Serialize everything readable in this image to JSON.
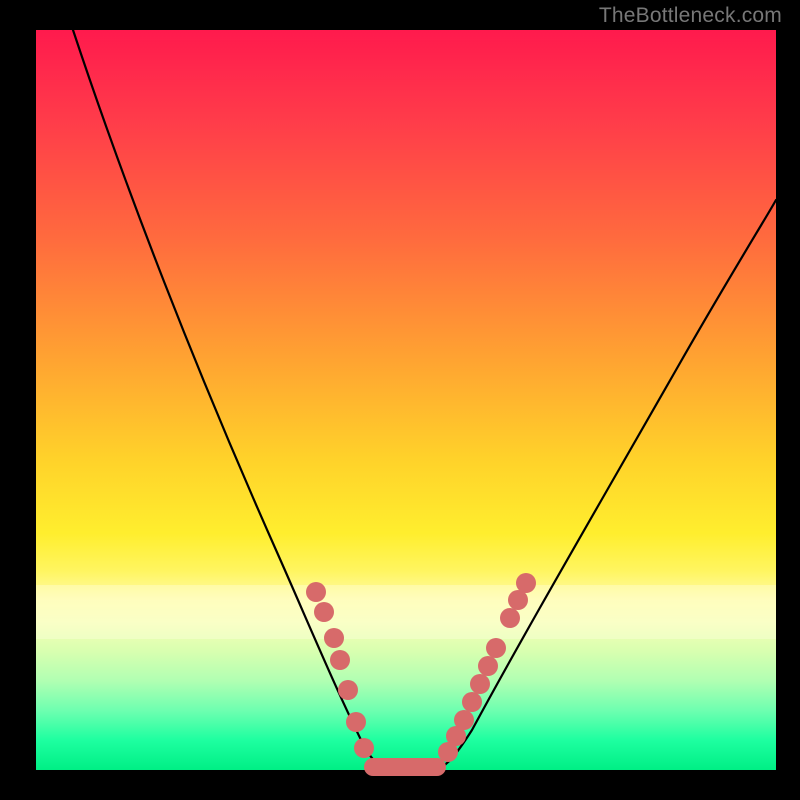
{
  "watermark": "TheBottleneck.com",
  "chart_data": {
    "type": "line",
    "title": "",
    "xlabel": "",
    "ylabel": "",
    "xlim": [
      0,
      100
    ],
    "ylim": [
      0,
      100
    ],
    "grid": false,
    "legend": false,
    "series": [
      {
        "name": "bottleneck-curve",
        "x": [
          5,
          10,
          15,
          20,
          25,
          30,
          35,
          38,
          40,
          42,
          44,
          46,
          48,
          50,
          55,
          60,
          65,
          70,
          75,
          80,
          85,
          90,
          95,
          100
        ],
        "y": [
          100,
          88,
          76,
          64,
          52,
          40,
          28,
          18,
          12,
          7,
          3,
          1,
          0,
          0,
          2,
          6,
          12,
          19,
          26,
          33,
          41,
          49,
          56,
          62
        ]
      }
    ],
    "markers": {
      "name": "sample-points",
      "points": [
        {
          "x": 38,
          "y": 22
        },
        {
          "x": 39,
          "y": 18
        },
        {
          "x": 40,
          "y": 15
        },
        {
          "x": 41,
          "y": 11
        },
        {
          "x": 42,
          "y": 8
        },
        {
          "x": 44,
          "y": 4
        },
        {
          "x": 45,
          "y": 2
        },
        {
          "x": 55,
          "y": 2
        },
        {
          "x": 56,
          "y": 4
        },
        {
          "x": 57,
          "y": 6
        },
        {
          "x": 58,
          "y": 8
        },
        {
          "x": 59,
          "y": 11
        },
        {
          "x": 60,
          "y": 14
        },
        {
          "x": 62,
          "y": 19
        },
        {
          "x": 63,
          "y": 22
        },
        {
          "x": 64,
          "y": 25
        }
      ]
    },
    "flat_segment": {
      "x0": 45,
      "x1": 55,
      "y": 0
    },
    "gradient_stops": [
      {
        "pos": 0.0,
        "color": "#ff1a4d"
      },
      {
        "pos": 0.45,
        "color": "#ffa531"
      },
      {
        "pos": 0.68,
        "color": "#ffee2e"
      },
      {
        "pos": 0.88,
        "color": "#b0ffb2"
      },
      {
        "pos": 1.0,
        "color": "#00ef85"
      }
    ]
  }
}
